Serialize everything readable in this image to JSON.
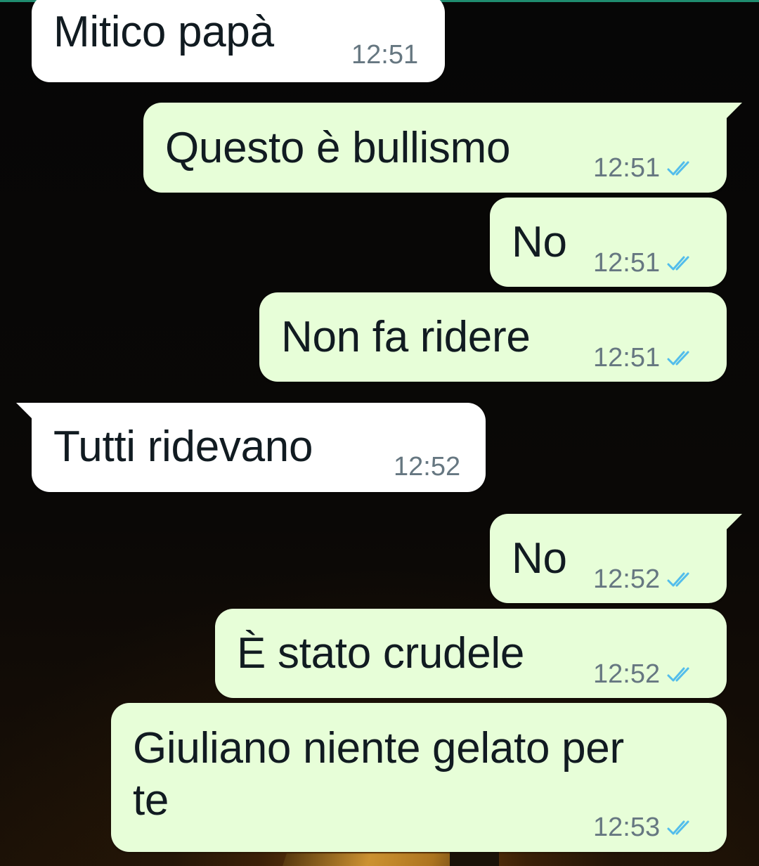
{
  "chat": {
    "messages": [
      {
        "direction": "incoming",
        "text": "Mitico papà",
        "time": "12:51",
        "status": ""
      },
      {
        "direction": "outgoing",
        "text": "Questo è bullismo",
        "time": "12:51",
        "status": "read"
      },
      {
        "direction": "outgoing",
        "text": "No",
        "time": "12:51",
        "status": "read"
      },
      {
        "direction": "outgoing",
        "text": "Non fa ridere",
        "time": "12:51",
        "status": "read"
      },
      {
        "direction": "incoming",
        "text": "Tutti ridevano",
        "time": "12:52",
        "status": ""
      },
      {
        "direction": "outgoing",
        "text": "No",
        "time": "12:52",
        "status": "read"
      },
      {
        "direction": "outgoing",
        "text": "È stato crudele",
        "time": "12:52",
        "status": "read"
      },
      {
        "direction": "outgoing",
        "text": "Giuliano niente gelato per te",
        "time": "12:53",
        "status": "read"
      }
    ]
  },
  "colors": {
    "incoming_bubble": "#ffffff",
    "outgoing_bubble": "#e7fed8",
    "read_ticks": "#53bdeb",
    "time_text": "#667781",
    "accent_line": "#1f8c6f"
  },
  "icons": {
    "read_status": "double-check-icon"
  }
}
